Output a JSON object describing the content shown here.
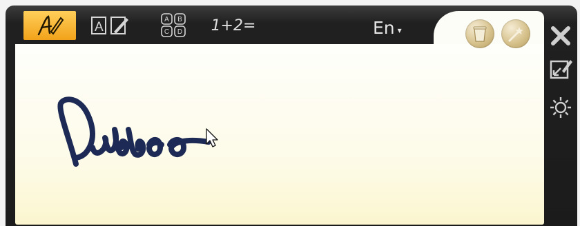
{
  "toolbar": {
    "handwriting_mode": {
      "icon": "handwriting-pen-icon",
      "active": true
    },
    "text_mode": {
      "icon": "text-box-pen-icon",
      "box_letter": "A"
    },
    "keypad_mode": {
      "icon": "letter-keys-icon",
      "keys": [
        "A",
        "B",
        "C",
        "D"
      ]
    },
    "math_mode": {
      "label": "1+2="
    },
    "language": {
      "label": "En",
      "arrow": "▾"
    }
  },
  "pad_actions": [
    {
      "name": "clear",
      "icon": "trash-can-icon"
    },
    {
      "name": "magic",
      "icon": "magic-wand-icon"
    }
  ],
  "side_panel": [
    {
      "name": "close",
      "icon": "close-icon"
    },
    {
      "name": "expand",
      "icon": "expand-window-icon"
    },
    {
      "name": "settings",
      "icon": "gear-icon"
    }
  ],
  "colors": {
    "accent": "#f2a21a",
    "frame": "#1b1b1b",
    "pad": "#fdfbe8",
    "ink": "#1d2a55"
  }
}
